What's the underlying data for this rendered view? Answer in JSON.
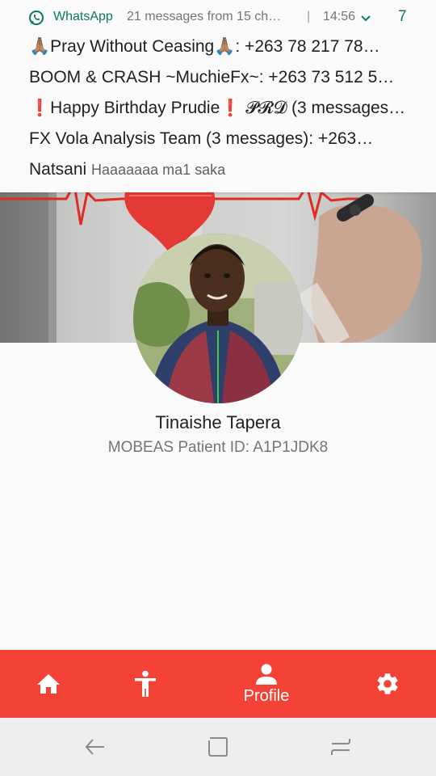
{
  "notification": {
    "app_name": "WhatsApp",
    "summary": "21 messages from 15 ch…",
    "separator": "|",
    "time": "14:56",
    "count": "7",
    "messages": [
      {
        "text": "🙏🏽Pray Without Ceasing🙏🏽: +263 78 217 78…"
      },
      {
        "text": "BOOM & CRASH ~MuchieFx~: +263 73 512 5…"
      },
      {
        "text_prefix": "❗",
        "text_main": "Happy Birthday Prudie",
        "text_suffix": "❗",
        "text_rest": " 𝓟𝓡𝓓 (3 messages…"
      },
      {
        "text": "FX Vola Analysis Team (3 messages): +263…"
      },
      {
        "sender": "Natsani",
        "body": "Haaaaaaa  ma1 saka"
      }
    ]
  },
  "profile": {
    "name": "Tinaishe Tapera",
    "patient_id": "MOBEAS Patient ID: A1P1JDK8"
  },
  "bottom_nav": {
    "items": [
      {
        "icon": "home-icon",
        "label": ""
      },
      {
        "icon": "accessibility-icon",
        "label": ""
      },
      {
        "icon": "person-icon",
        "label": "Profile"
      },
      {
        "icon": "gear-icon",
        "label": ""
      }
    ]
  },
  "colors": {
    "accent": "#f44336",
    "whatsapp_green": "#0b7a5c",
    "nav_bar": "#eeeeee"
  }
}
